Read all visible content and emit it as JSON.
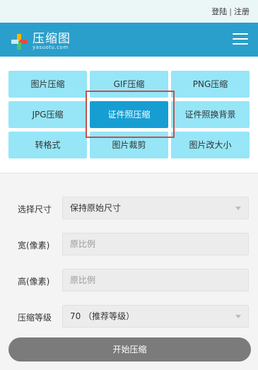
{
  "topbar": {
    "login": "登陆",
    "separator": "|",
    "register": "注册"
  },
  "header": {
    "title": "压缩图",
    "subtitle": "yasuotu.com",
    "menu_icon": "hamburger-icon",
    "logo_icon": "pinwheel-logo-icon"
  },
  "tools": [
    {
      "label": "图片压缩",
      "active": false
    },
    {
      "label": "GIF压缩",
      "active": false
    },
    {
      "label": "PNG压缩",
      "active": false
    },
    {
      "label": "JPG压缩",
      "active": false
    },
    {
      "label": "证件照压缩",
      "active": true
    },
    {
      "label": "证件照换背景",
      "active": false
    },
    {
      "label": "转格式",
      "active": false
    },
    {
      "label": "图片裁剪",
      "active": false
    },
    {
      "label": "图片改大小",
      "active": false
    }
  ],
  "form": {
    "size": {
      "label": "选择尺寸",
      "value": "保持原始尺寸"
    },
    "width": {
      "label": "宽(像素)",
      "placeholder": "原比例"
    },
    "height": {
      "label": "高(像素)",
      "placeholder": "原比例"
    },
    "level": {
      "label": "压缩等级",
      "value": "70 （推荐等级）"
    }
  },
  "start_button": "开始压缩",
  "colors": {
    "header": "#2b9fcb",
    "tool": "#96e6f7",
    "tool_active": "#169ed3",
    "highlight": "#c8504c",
    "start_button": "#7b7b7b"
  }
}
